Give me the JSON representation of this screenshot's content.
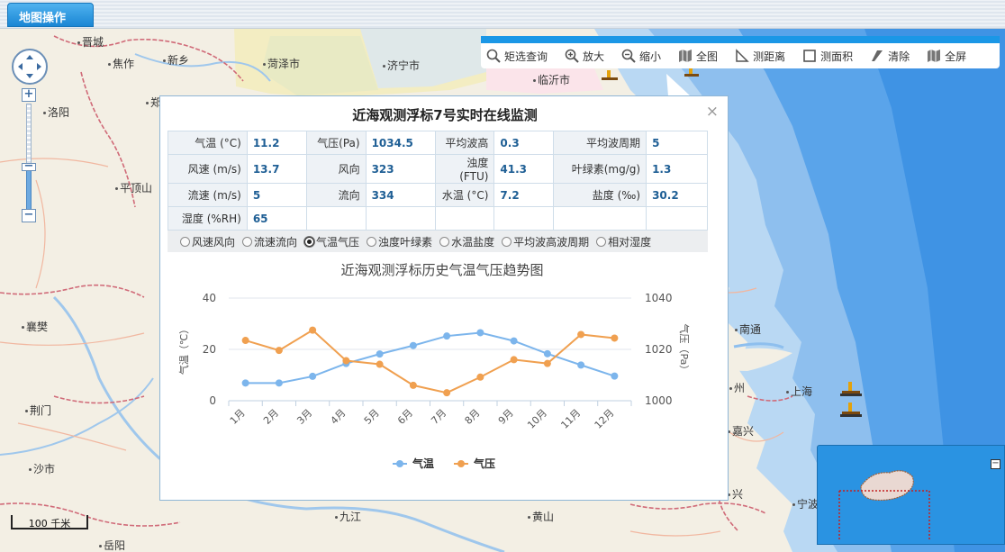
{
  "tab": {
    "title": "地图操作"
  },
  "toolbar": {
    "items": [
      {
        "label": "矩选查询",
        "icon": "search-icon"
      },
      {
        "label": "放大",
        "icon": "zoom-in-icon"
      },
      {
        "label": "缩小",
        "icon": "zoom-out-icon"
      },
      {
        "label": "全图",
        "icon": "full-map-icon"
      },
      {
        "label": "测距离",
        "icon": "measure-distance-icon"
      },
      {
        "label": "测面积",
        "icon": "measure-area-icon"
      },
      {
        "label": "清除",
        "icon": "eraser-icon"
      },
      {
        "label": "全屏",
        "icon": "fullscreen-icon"
      }
    ]
  },
  "map": {
    "cities": [
      "晋城",
      "焦作",
      "新乡",
      "菏泽市",
      "济宁市",
      "临沂市",
      "洛阳",
      "郑",
      "平顶山",
      "襄樊",
      "荆门",
      "沙市",
      "南通",
      "上海",
      "州",
      "嘉兴",
      "兴",
      "宁波",
      "九江",
      "黄山",
      "岳阳"
    ],
    "scale_label": "100 千米"
  },
  "popup": {
    "title": "近海观测浮标7号实时在线监测",
    "close": "×",
    "rows": [
      [
        [
          "气温 (°C)",
          "11.2"
        ],
        [
          "气压(Pa)",
          "1034.5"
        ],
        [
          "平均波高",
          "0.3"
        ],
        [
          "平均波周期",
          "5"
        ]
      ],
      [
        [
          "风速 (m/s)",
          "13.7"
        ],
        [
          "风向",
          "323"
        ],
        [
          "浊度(FTU)",
          "41.3"
        ],
        [
          "叶绿素(mg/g)",
          "1.3"
        ]
      ],
      [
        [
          "流速 (m/s)",
          "5"
        ],
        [
          "流向",
          "334"
        ],
        [
          "水温 (°C)",
          "7.2"
        ],
        [
          "盐度 (‰)",
          "30.2"
        ]
      ],
      [
        [
          "湿度 (%RH)",
          "65"
        ],
        [
          "",
          ""
        ],
        [
          "",
          ""
        ],
        [
          "",
          ""
        ]
      ]
    ],
    "radios": [
      {
        "label": "风速风向",
        "checked": false
      },
      {
        "label": "流速流向",
        "checked": false
      },
      {
        "label": "气温气压",
        "checked": true
      },
      {
        "label": "浊度叶绿素",
        "checked": false
      },
      {
        "label": "水温盐度",
        "checked": false
      },
      {
        "label": "平均波高波周期",
        "checked": false
      },
      {
        "label": "相对湿度",
        "checked": false
      }
    ]
  },
  "chart_data": {
    "type": "line",
    "title": "近海观测浮标历史气温气压趋势图",
    "categories": [
      "1月",
      "2月",
      "3月",
      "4月",
      "5月",
      "6月",
      "7月",
      "8月",
      "9月",
      "10月",
      "11月",
      "12月"
    ],
    "ylabel_left": "气温（℃）",
    "ylabel_right": "气压（Pa）",
    "ylim_left": [
      0,
      40
    ],
    "ylim_right": [
      1000,
      1040
    ],
    "yticks_left": [
      "0",
      "20",
      "40"
    ],
    "yticks_right": [
      "1000",
      "1020",
      "1040"
    ],
    "legend_position": "bottom",
    "grid": true,
    "series": [
      {
        "name": "气温",
        "axis": "left",
        "color": "#7cb5ec",
        "values": [
          6.9,
          6.9,
          9.5,
          14.5,
          18.2,
          21.5,
          25.2,
          26.5,
          23.3,
          18.3,
          13.9,
          9.6
        ]
      },
      {
        "name": "气压",
        "axis": "right",
        "color": "#f0a050",
        "values": [
          1023.5,
          1019.6,
          1027.5,
          1015.6,
          1014.2,
          1006.0,
          1003.1,
          1009.2,
          1016.0,
          1014.5,
          1025.8,
          1024.4
        ]
      }
    ]
  }
}
